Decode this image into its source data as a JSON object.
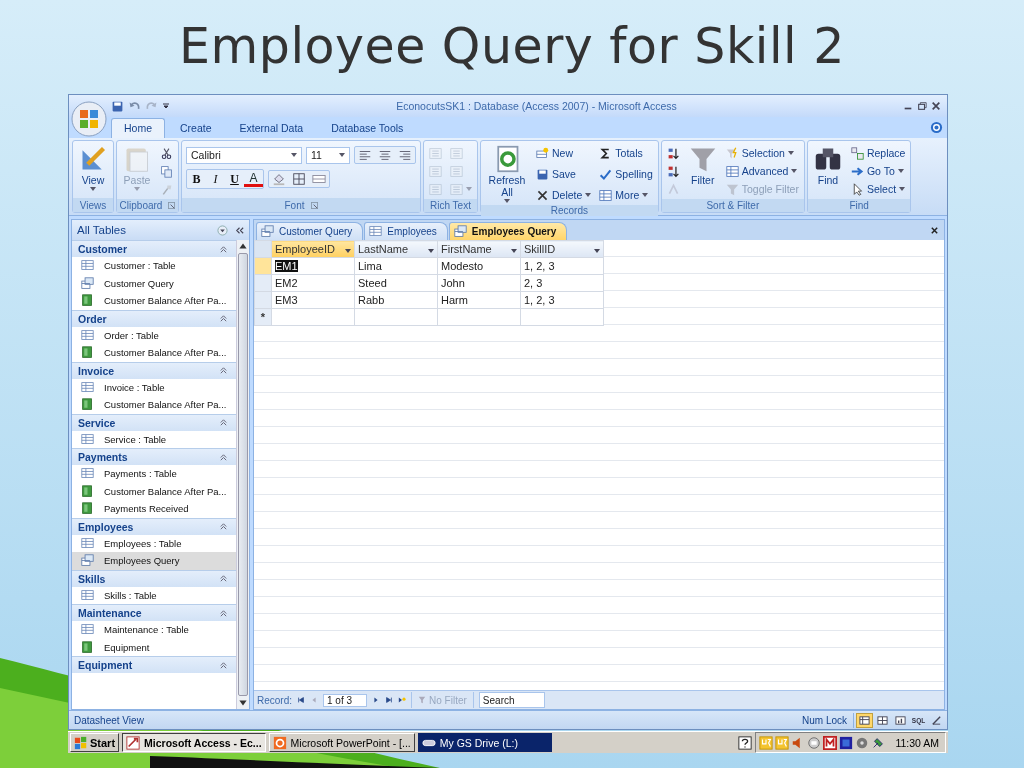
{
  "slide": {
    "title": "Employee Query for Skill 2"
  },
  "window": {
    "title": "EconocutsSK1 : Database (Access 2007) - Microsoft Access"
  },
  "ribbon_tabs": [
    {
      "label": "Home",
      "selected": true
    },
    {
      "label": "Create",
      "selected": false
    },
    {
      "label": "External Data",
      "selected": false
    },
    {
      "label": "Database Tools",
      "selected": false
    }
  ],
  "ribbon_groups": [
    {
      "kind": "buttons",
      "label": "Views",
      "launcher": false,
      "buttons": [
        {
          "label": "View",
          "kind": "large",
          "dropdown": true,
          "disabled": false
        }
      ]
    },
    {
      "kind": "buttons",
      "label": "Clipboard",
      "launcher": true,
      "buttons": [
        {
          "label": "Paste",
          "kind": "large",
          "dropdown": true,
          "disabled": true
        },
        {
          "kind": "small",
          "dropdown": false,
          "disabled": false
        },
        {
          "kind": "small",
          "dropdown": false,
          "disabled": false
        },
        {
          "kind": "small",
          "dropdown": false,
          "disabled": true
        }
      ]
    },
    {
      "kind": "font",
      "label": "Font",
      "launcher": true,
      "font_name": "Calibri",
      "font_size": "11",
      "format_buttons": [
        "B",
        "I",
        "U",
        "A"
      ]
    },
    {
      "kind": "buttons",
      "label": "Rich Text",
      "launcher": false,
      "buttons": [
        {
          "kind": "small",
          "dropdown": false,
          "disabled": true
        },
        {
          "kind": "small",
          "dropdown": false,
          "disabled": true
        },
        {
          "kind": "small",
          "dropdown": false,
          "disabled": true
        },
        {
          "kind": "small",
          "dropdown": false,
          "disabled": true
        },
        {
          "kind": "small",
          "dropdown": false,
          "disabled": true
        },
        {
          "kind": "small",
          "dropdown": true,
          "disabled": true
        }
      ]
    },
    {
      "kind": "buttons",
      "label": "Records",
      "launcher": false,
      "buttons": [
        {
          "label": "Refresh All",
          "kind": "large",
          "dropdown": true,
          "disabled": false
        },
        {
          "label": "New",
          "kind": "small",
          "dropdown": false,
          "disabled": false
        },
        {
          "label": "Save",
          "kind": "small",
          "dropdown": false,
          "disabled": false
        },
        {
          "label": "Delete",
          "kind": "small",
          "dropdown": true,
          "disabled": false
        },
        {
          "label": "Totals",
          "kind": "small",
          "dropdown": false,
          "disabled": false
        },
        {
          "label": "Spelling",
          "kind": "small",
          "dropdown": false,
          "disabled": false
        },
        {
          "label": "More",
          "kind": "small",
          "dropdown": true,
          "disabled": false
        }
      ]
    },
    {
      "kind": "buttons",
      "label": "Sort & Filter",
      "launcher": false,
      "buttons": [
        {
          "kind": "small",
          "dropdown": false,
          "disabled": false
        },
        {
          "kind": "small",
          "dropdown": false,
          "disabled": false
        },
        {
          "kind": "small",
          "dropdown": false,
          "disabled": true
        },
        {
          "label": "Filter",
          "kind": "large",
          "dropdown": false,
          "disabled": false
        },
        {
          "label": "Selection",
          "kind": "small",
          "dropdown": true,
          "disabled": false
        },
        {
          "label": "Advanced",
          "kind": "small",
          "dropdown": true,
          "disabled": false
        },
        {
          "label": "Toggle Filter",
          "kind": "small",
          "dropdown": false,
          "disabled": true
        }
      ]
    },
    {
      "kind": "buttons",
      "label": "Find",
      "launcher": false,
      "buttons": [
        {
          "label": "Find",
          "kind": "large",
          "dropdown": false,
          "disabled": false
        },
        {
          "label": "Replace",
          "kind": "small",
          "dropdown": false,
          "disabled": false
        },
        {
          "label": "Go To",
          "kind": "small",
          "dropdown": true,
          "disabled": false
        },
        {
          "label": "Select",
          "kind": "small",
          "dropdown": true,
          "disabled": false
        }
      ]
    }
  ],
  "navigation_pane": {
    "title": "All Tables",
    "groups": [
      {
        "label": "Customer",
        "expanded": true,
        "items": [
          {
            "label": "Customer : Table",
            "kind": "table",
            "selected": false
          },
          {
            "label": "Customer Query",
            "kind": "query",
            "selected": false
          },
          {
            "label": "Customer Balance After Pa...",
            "kind": "report",
            "selected": false
          }
        ]
      },
      {
        "label": "Order",
        "expanded": true,
        "items": [
          {
            "label": "Order : Table",
            "kind": "table",
            "selected": false
          },
          {
            "label": "Customer Balance After Pa...",
            "kind": "report",
            "selected": false
          }
        ]
      },
      {
        "label": "Invoice",
        "expanded": true,
        "items": [
          {
            "label": "Invoice : Table",
            "kind": "table",
            "selected": false
          },
          {
            "label": "Customer Balance After Pa...",
            "kind": "report",
            "selected": false
          }
        ]
      },
      {
        "label": "Service",
        "expanded": true,
        "items": [
          {
            "label": "Service : Table",
            "kind": "table",
            "selected": false
          }
        ]
      },
      {
        "label": "Payments",
        "expanded": true,
        "items": [
          {
            "label": "Payments : Table",
            "kind": "table",
            "selected": false
          },
          {
            "label": "Customer Balance After Pa...",
            "kind": "report",
            "selected": false
          },
          {
            "label": "Payments Received",
            "kind": "report",
            "selected": false
          }
        ]
      },
      {
        "label": "Employees",
        "expanded": true,
        "items": [
          {
            "label": "Employees : Table",
            "kind": "table",
            "selected": false
          },
          {
            "label": "Employees Query",
            "kind": "query",
            "selected": true
          }
        ]
      },
      {
        "label": "Skills",
        "expanded": true,
        "items": [
          {
            "label": "Skills : Table",
            "kind": "table",
            "selected": false
          }
        ]
      },
      {
        "label": "Maintenance",
        "expanded": true,
        "items": [
          {
            "label": "Maintenance : Table",
            "kind": "table",
            "selected": false
          },
          {
            "label": "Equipment",
            "kind": "report",
            "selected": false
          }
        ]
      },
      {
        "label": "Equipment",
        "expanded": true
      }
    ]
  },
  "document_tabs": [
    {
      "label": "Customer Query",
      "kind": "query",
      "selected": false
    },
    {
      "label": "Employees",
      "kind": "table",
      "selected": false
    },
    {
      "label": "Employees Query",
      "kind": "query",
      "selected": true
    }
  ],
  "datasheet": {
    "columns": [
      {
        "label": "EmployeeID",
        "selected": true
      },
      {
        "label": "LastName",
        "selected": false
      },
      {
        "label": "FirstName",
        "selected": false
      },
      {
        "label": "SkillID",
        "selected": false
      }
    ],
    "rows": [
      {
        "cells": [
          "EM1",
          "Lima",
          "Modesto",
          "1, 2, 3"
        ],
        "selected": true
      },
      {
        "cells": [
          "EM2",
          "Steed",
          "John",
          "2, 3"
        ],
        "selected": false
      },
      {
        "cells": [
          "EM3",
          "Rabb",
          "Harm",
          "1, 2, 3"
        ],
        "selected": false
      }
    ],
    "new_row_marker": "*"
  },
  "record_navigator": {
    "label": "Record:",
    "position": "1 of 3",
    "filter": "No Filter",
    "search": {
      "placeholder": "Search"
    }
  },
  "status_bar": {
    "text": "Datasheet View",
    "indicator": "Num Lock",
    "view_buttons": [
      {
        "kind": "datasheet",
        "selected": true
      },
      {
        "kind": "pivot-table",
        "selected": false
      },
      {
        "kind": "pivot-chart",
        "selected": false
      },
      {
        "kind": "sql",
        "label": "SQL",
        "selected": false
      },
      {
        "kind": "design",
        "selected": false
      }
    ]
  },
  "taskbar": {
    "start": "Start",
    "tasks": [
      {
        "label": "Microsoft Access - Ec...",
        "kind": "access",
        "selected": true,
        "flashing": false
      },
      {
        "label": "Microsoft PowerPoint - [...",
        "kind": "powerpoint",
        "selected": false,
        "flashing": false
      },
      {
        "label": "My GS Drive (L:)",
        "kind": "drive",
        "selected": false,
        "flashing": true
      }
    ],
    "clock": "11:30 AM"
  }
}
